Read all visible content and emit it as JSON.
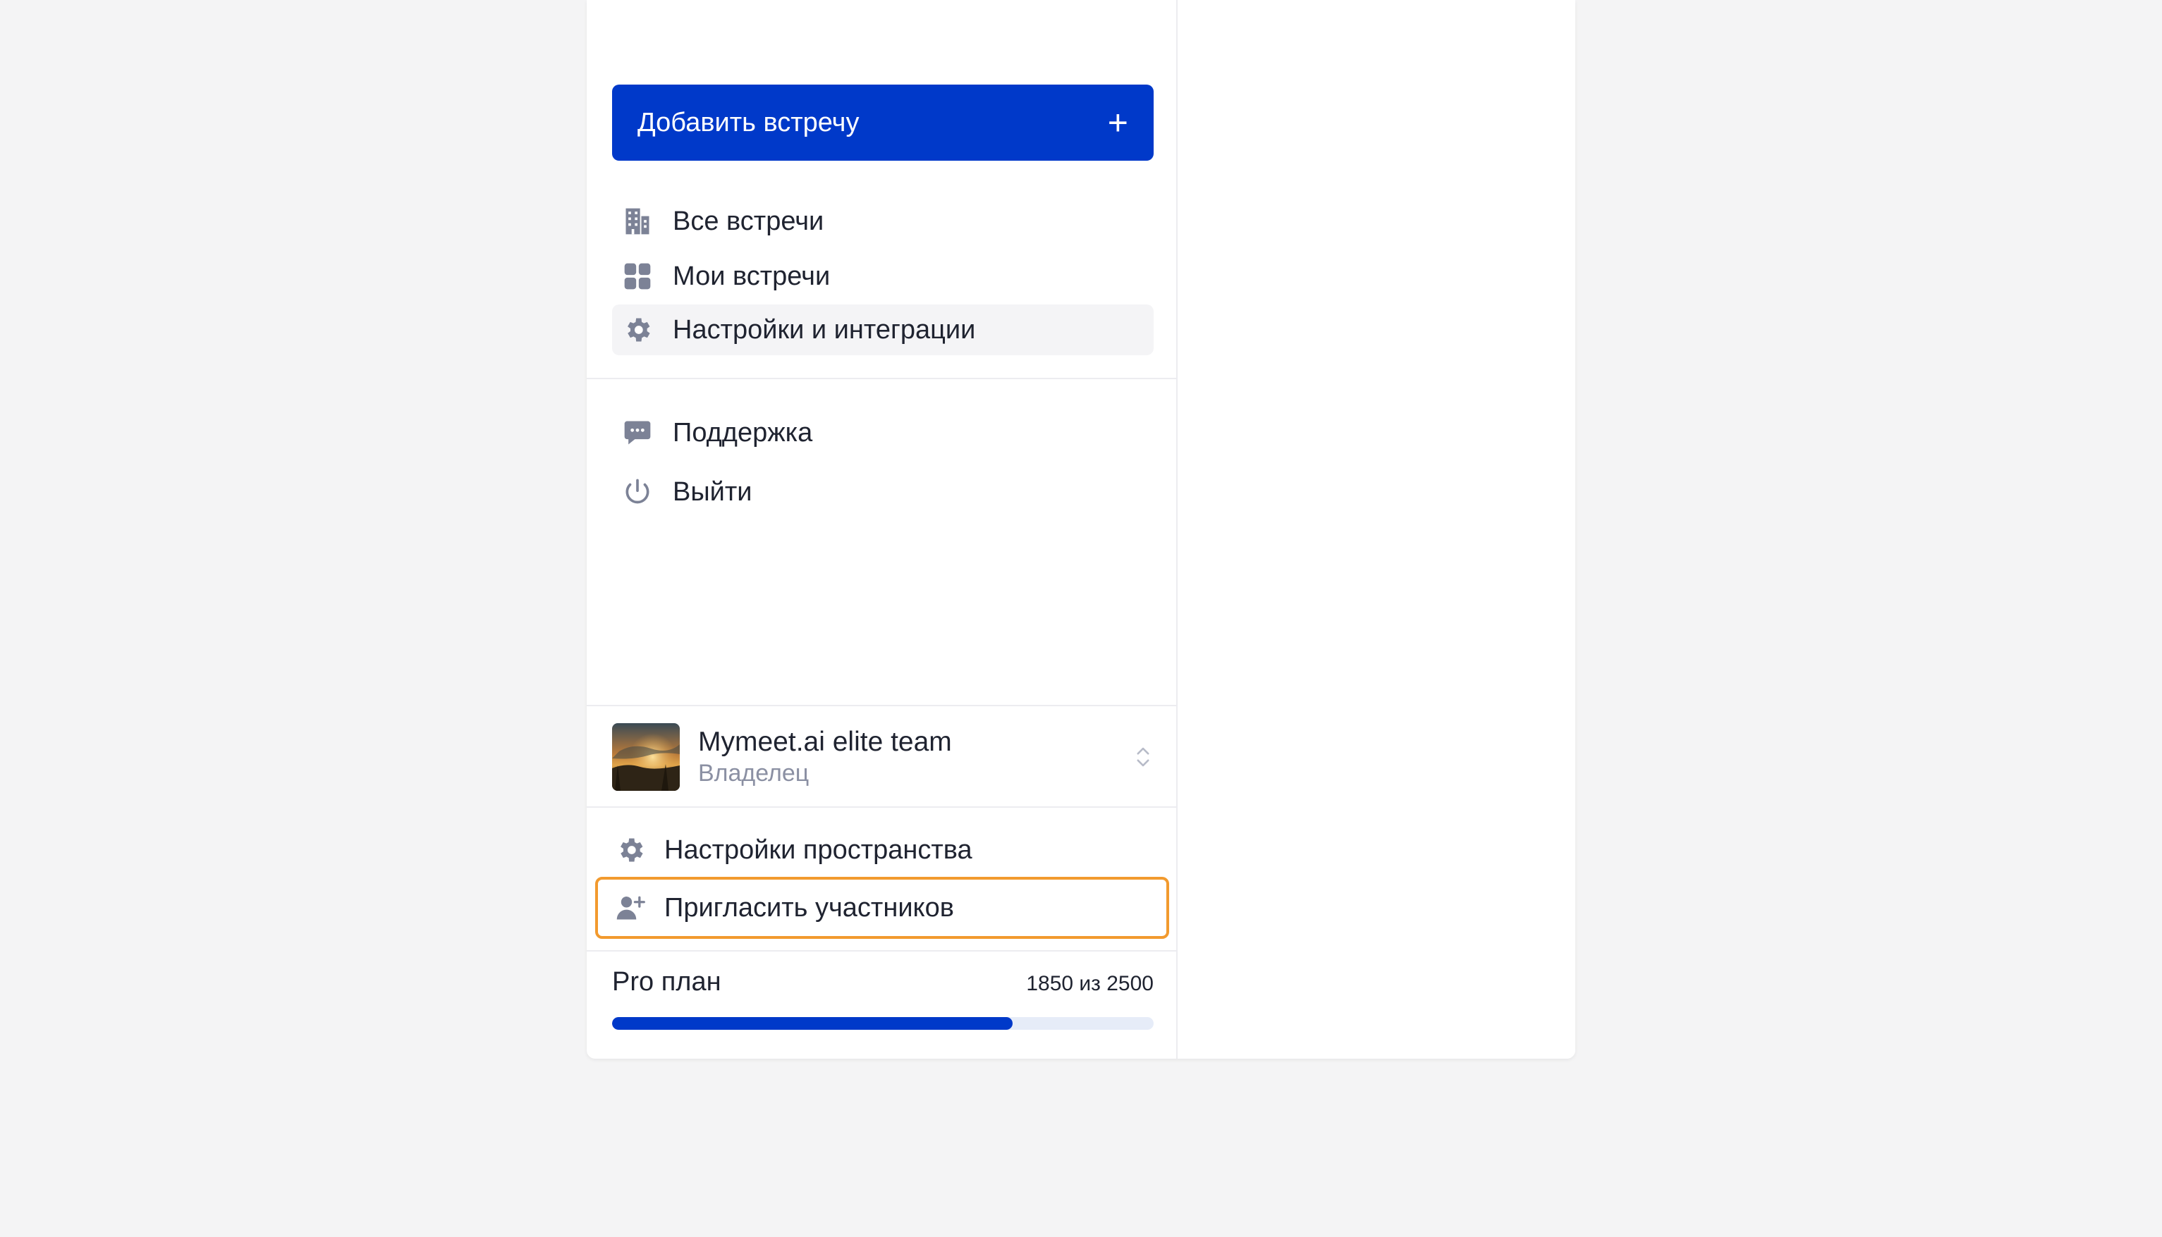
{
  "sidebar": {
    "add_button": {
      "label": "Добавить встречу",
      "icon": "plus-icon"
    },
    "nav": [
      {
        "label": "Все встречи",
        "icon": "building-icon"
      },
      {
        "label": "Мои встречи",
        "icon": "grid-icon"
      },
      {
        "label": "Настройки и интеграции",
        "icon": "gear-icon",
        "active": true
      }
    ],
    "secondary": [
      {
        "label": "Поддержка",
        "icon": "chat-icon"
      },
      {
        "label": "Выйти",
        "icon": "power-icon"
      }
    ]
  },
  "workspace": {
    "name": "Mymeet.ai elite team",
    "role": "Владелец",
    "items": [
      {
        "label": "Настройки пространства",
        "icon": "gear-icon"
      },
      {
        "label": "Пригласить участников",
        "icon": "add-user-icon",
        "focused": true
      }
    ]
  },
  "plan": {
    "title": "Pro план",
    "usage_text": "1850 из 2500",
    "used": 1850,
    "total": 2500
  },
  "colors": {
    "accent": "#0039c9",
    "focus_ring": "#f29a2e",
    "icon": "#7c8296",
    "muted_text": "#8b90a3"
  }
}
